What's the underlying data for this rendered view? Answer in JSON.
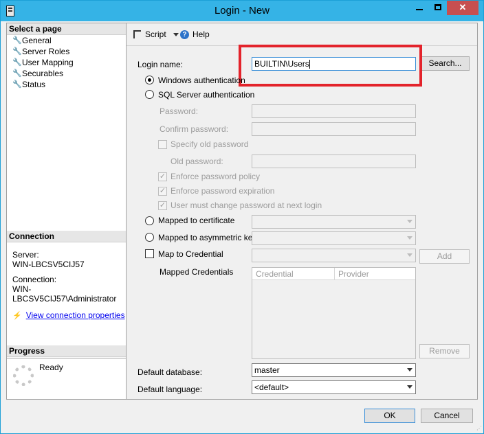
{
  "window": {
    "title": "Login - New",
    "controls": [
      "minimize-icon",
      "maximize-icon",
      "close-icon"
    ],
    "accent_color": "#35b3e6",
    "close_color": "#c74f50"
  },
  "left_pane": {
    "select_page": {
      "header": "Select a page",
      "items": [
        {
          "label": "General"
        },
        {
          "label": "Server Roles"
        },
        {
          "label": "User Mapping"
        },
        {
          "label": "Securables"
        },
        {
          "label": "Status"
        }
      ]
    },
    "connection": {
      "header": "Connection",
      "server_label": "Server:",
      "server_value": "WIN-LBCSV5CIJ57",
      "connection_label": "Connection:",
      "connection_value": "WIN-LBCSV5CIJ57\\Administrator",
      "view_link": "View connection properties"
    },
    "progress": {
      "header": "Progress",
      "status": "Ready"
    }
  },
  "toolbar": {
    "script_label": "Script",
    "help_label": "Help"
  },
  "form": {
    "login_name_label": "Login name:",
    "login_name_value": "BUILTIN\\Users",
    "search_button": "Search...",
    "windows_auth": "Windows authentication",
    "sql_auth": "SQL Server authentication",
    "password_label": "Password:",
    "confirm_password_label": "Confirm password:",
    "specify_old_password": "Specify old password",
    "old_password_label": "Old password:",
    "enforce_policy": "Enforce password policy",
    "enforce_expiration": "Enforce password expiration",
    "must_change": "User must change password at next login",
    "mapped_certificate": "Mapped to certificate",
    "mapped_asym_key": "Mapped to asymmetric key",
    "map_credential": "Map to Credential",
    "add_button": "Add",
    "mapped_credentials_label": "Mapped Credentials",
    "credentials_columns": [
      "Credential",
      "Provider"
    ],
    "remove_button": "Remove",
    "default_database_label": "Default database:",
    "default_database_value": "master",
    "default_language_label": "Default language:",
    "default_language_value": "<default>",
    "highlight_color": "#e3232b"
  },
  "footer": {
    "ok_button": "OK",
    "cancel_button": "Cancel"
  }
}
